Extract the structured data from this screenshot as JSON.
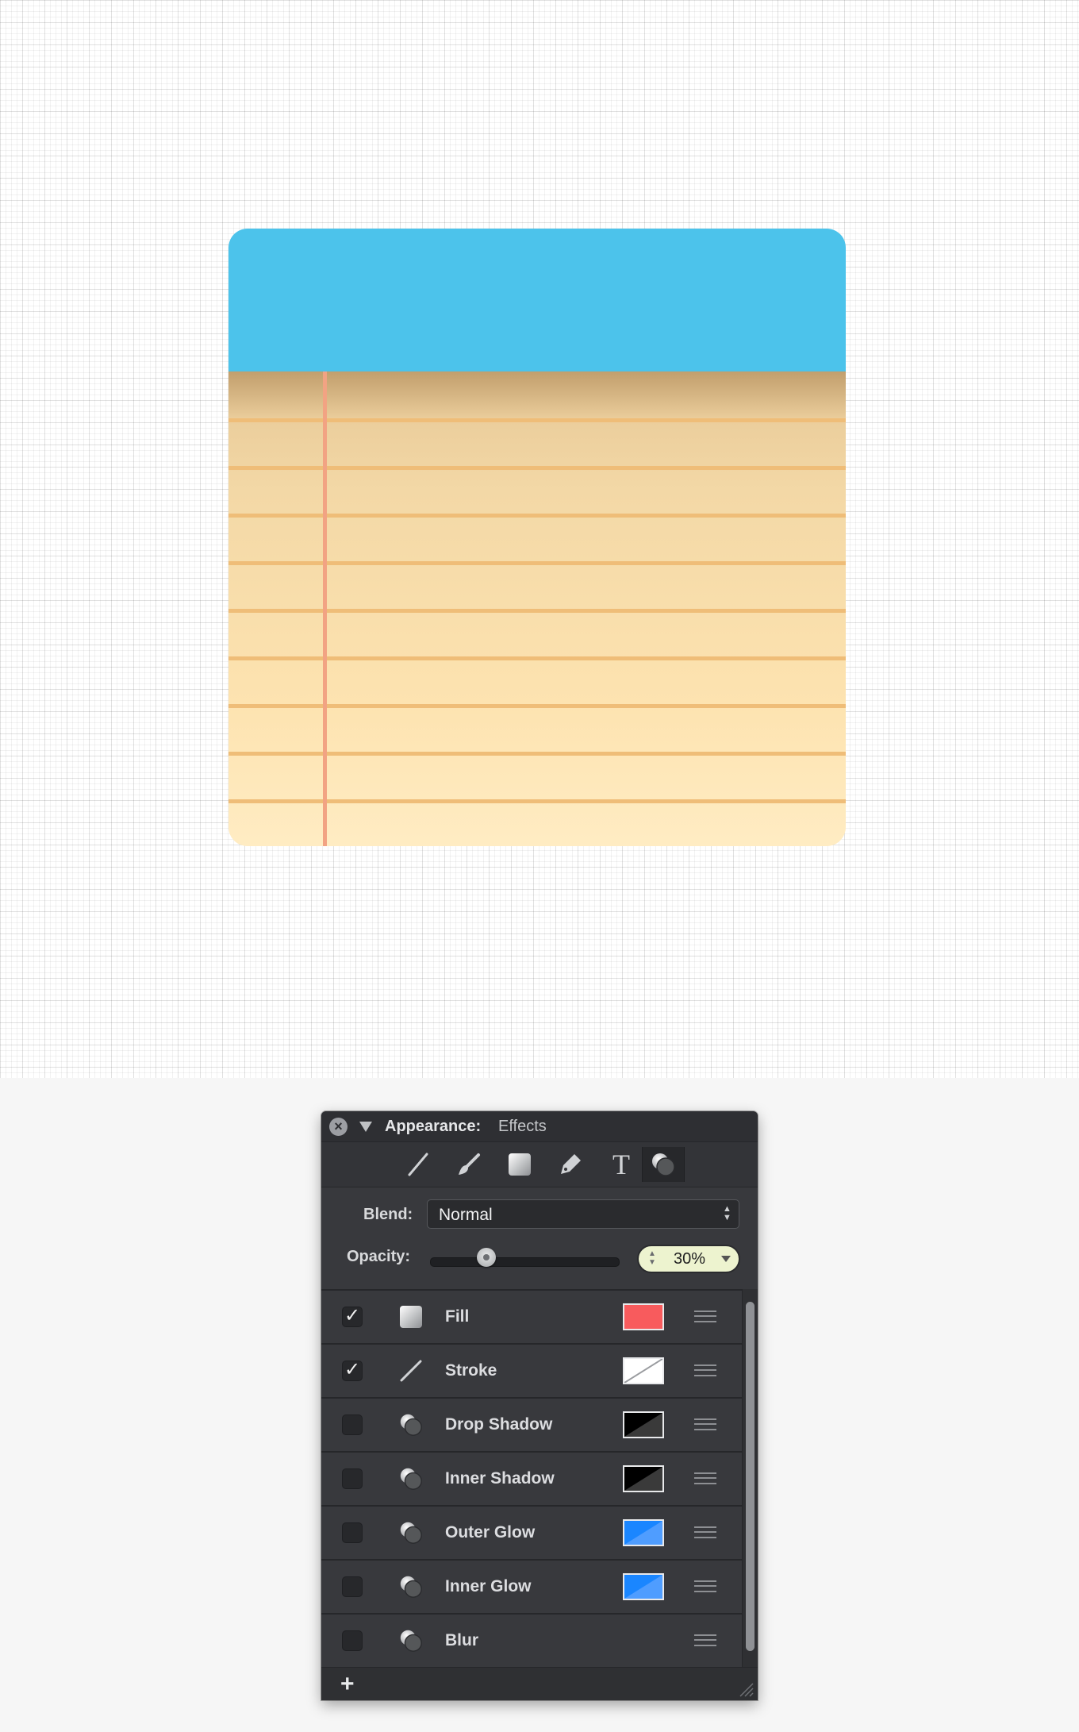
{
  "panel": {
    "title": "Appearance:",
    "subtitle": "Effects",
    "tools": [
      {
        "name": "stroke-tool-icon"
      },
      {
        "name": "brush-tool-icon"
      },
      {
        "name": "fill-tool-icon"
      },
      {
        "name": "tag-tool-icon"
      },
      {
        "name": "text-tool-icon",
        "glyph": "T"
      },
      {
        "name": "effects-tool-icon",
        "active": true
      }
    ],
    "blend_label": "Blend:",
    "blend_value": "Normal",
    "opacity_label": "Opacity:",
    "opacity_value": "30%",
    "opacity_level": 0.3,
    "effects": [
      {
        "label": "Fill",
        "checked": true,
        "check_glyph": "✓",
        "icon": "fill-icon",
        "swatch": "#f85b5d"
      },
      {
        "label": "Stroke",
        "checked": true,
        "check_glyph": "✓",
        "icon": "stroke-icon",
        "swatch": "#ffffff"
      },
      {
        "label": "Drop Shadow",
        "checked": false,
        "check_glyph": "",
        "icon": "shadow-icon",
        "swatch": "#000000"
      },
      {
        "label": "Inner Shadow",
        "checked": false,
        "check_glyph": "",
        "icon": "shadow-icon",
        "swatch": "#000000"
      },
      {
        "label": "Outer Glow",
        "checked": false,
        "check_glyph": "",
        "icon": "shadow-icon",
        "swatch": "#1a86ff"
      },
      {
        "label": "Inner Glow",
        "checked": false,
        "check_glyph": "",
        "icon": "shadow-icon",
        "swatch": "#1a86ff"
      },
      {
        "label": "Blur",
        "checked": false,
        "check_glyph": "",
        "icon": "shadow-icon",
        "swatch": ""
      }
    ],
    "add_label": "+"
  },
  "canvas": {
    "notepad_header_color": "#4cc3eb",
    "paper_rule_color": "#efbd78",
    "margin_line_color": "#f2a383"
  }
}
